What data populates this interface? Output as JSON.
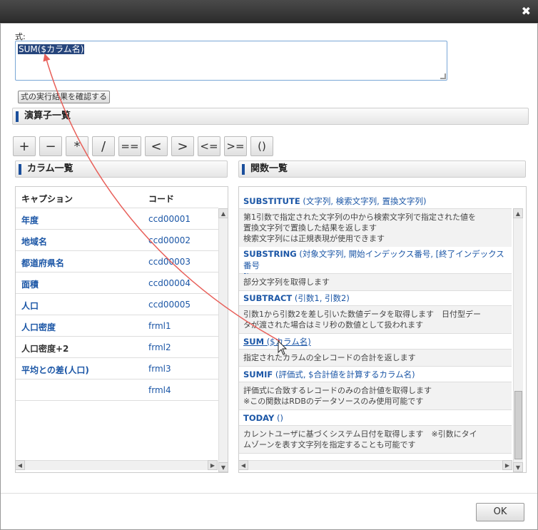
{
  "close_glyph": "✖",
  "expression": {
    "label": "式:",
    "value": "SUM($カラム名)",
    "check_button": "式の実行結果を確認する"
  },
  "operators": {
    "title": "演算子一覧",
    "items": [
      "+",
      "−",
      "*",
      "/",
      "==",
      "<",
      ">",
      "<=",
      ">=",
      "()"
    ]
  },
  "columns": {
    "title": "カラム一覧",
    "headers": {
      "caption": "キャプション",
      "code": "コード"
    },
    "rows": [
      {
        "caption": "年度",
        "code": "ccd00001"
      },
      {
        "caption": "地域名",
        "code": "ccd00002"
      },
      {
        "caption": "都道府県名",
        "code": "ccd00003"
      },
      {
        "caption": "面積",
        "code": "ccd00004"
      },
      {
        "caption": "人口",
        "code": "ccd00005"
      },
      {
        "caption": "人口密度",
        "code": "frml1"
      },
      {
        "caption": "人口密度+2",
        "code": "frml2"
      },
      {
        "caption": "平均との差(人口)",
        "code": "frml3"
      },
      {
        "caption": "",
        "code": "frml4"
      }
    ]
  },
  "functions": {
    "title": "関数一覧",
    "items": [
      {
        "name": "SUBSTITUTE",
        "args": " (文字列, 検索文字列, 置換文字列)",
        "desc": [
          "第1引数で指定された文字列の中から検索文字列で指定された値を",
          "置換文字列で置換した結果を返します",
          "検索文字列には正規表現が使用できます"
        ]
      },
      {
        "name": "SUBSTRING",
        "args": " (対象文字列, 開始インデックス番号, [終了インデックス番号",
        "args2": "])",
        "desc": [
          "部分文字列を取得します"
        ]
      },
      {
        "name": "SUBTRACT",
        "args": " (引数1, 引数2)",
        "desc": [
          "引数1から引数2を差し引いた数値データを取得します　日付型デー",
          "タが渡された場合はミリ秒の数値として扱われます"
        ]
      },
      {
        "name": "SUM",
        "args": " ($カラム名)",
        "desc": [
          "指定されたカラムの全レコードの合計を返します"
        ]
      },
      {
        "name": "SUMIF",
        "args": " (評価式, $合計値を計算するカラム名)",
        "desc": [
          "評価式に合致するレコードのみの合計値を取得します",
          "※この関数はRDBのデータソースのみ使用可能です"
        ]
      },
      {
        "name": "TODAY",
        "args": " ()",
        "desc": [
          "カレントユーザに基づくシステム日付を取得します　※引数にタイ",
          "ムゾーンを表す文字列を指定することも可能です"
        ]
      }
    ]
  },
  "ok_label": "OK",
  "colors": {
    "accent": "#1b56a6",
    "annotation": "#e8605a",
    "selection": "#26457c"
  }
}
